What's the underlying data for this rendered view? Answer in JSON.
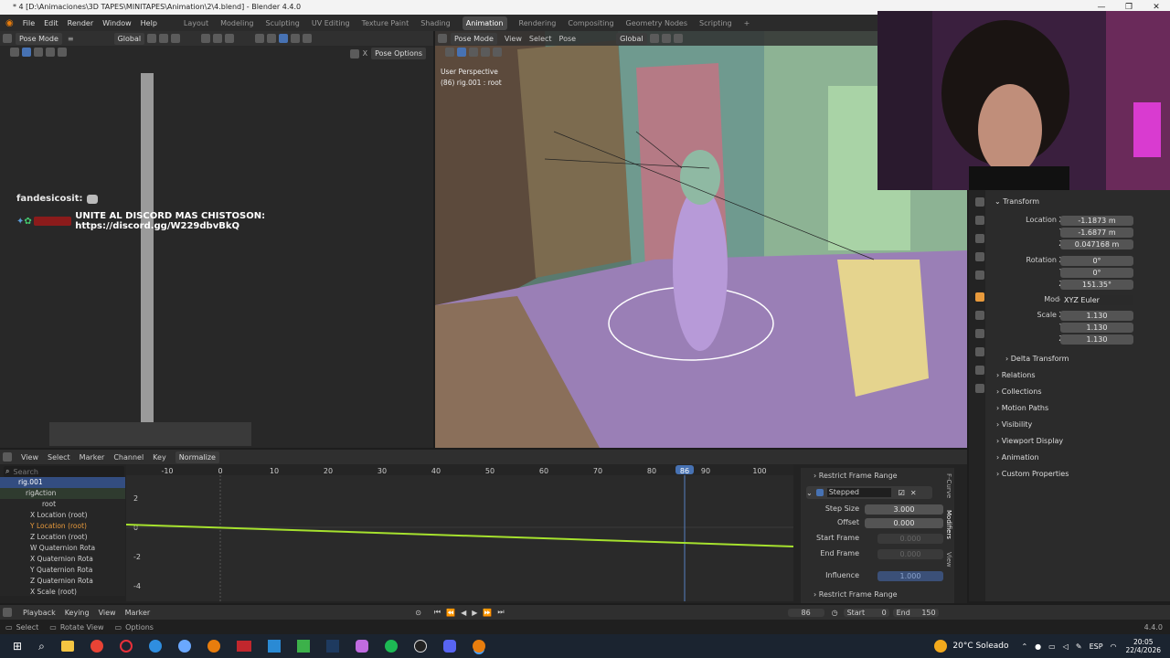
{
  "window": {
    "title": "* 4 [D:\\Animaciones\\3D TAPES\\MINITAPES\\Animation\\2\\4.blend] - Blender 4.4.0",
    "controls": [
      "—",
      "❐",
      "✕"
    ]
  },
  "menu": {
    "items": [
      "File",
      "Edit",
      "Render",
      "Window",
      "Help"
    ]
  },
  "workspaces": {
    "tabs": [
      "Layout",
      "Modeling",
      "Sculpting",
      "UV Editing",
      "Texture Paint",
      "Shading",
      "Animation",
      "Rendering",
      "Compositing",
      "Geometry Nodes",
      "Scripting"
    ],
    "active": "Animation",
    "add": "+"
  },
  "left_header": {
    "mode": "Pose Mode",
    "orientation": "Global",
    "pose_options": "Pose Options"
  },
  "viewport": {
    "mode": "Pose Mode",
    "view": "View",
    "select": "Select",
    "pose": "Pose",
    "orientation": "Global",
    "perspective": "User Perspective",
    "object": "(86) rig.001 : root"
  },
  "chat": {
    "user": "fandesicosit:",
    "user2": "",
    "message": "UNITE AL DISCORD MAS CHISTOSON: https://discord.gg/W229dbvBkQ"
  },
  "properties": {
    "section_transform": "Transform",
    "location": {
      "label": "Location X",
      "x": "-1.1873 m",
      "y": "-1.6877 m",
      "z": "0.047168 m"
    },
    "rotation": {
      "label": "Rotation X",
      "x": "0°",
      "y": "0°",
      "z": "151.35°"
    },
    "mode": {
      "label": "Mode",
      "value": "XYZ Euler"
    },
    "scale": {
      "label": "Scale X",
      "x": "1.130",
      "y": "1.130",
      "z": "1.130"
    },
    "axis_y": "Y",
    "axis_z": "Z",
    "delta": "Delta Transform",
    "sections": [
      "Relations",
      "Collections",
      "Motion Paths",
      "Visibility",
      "Viewport Display",
      "Animation",
      "Custom Properties"
    ]
  },
  "graph_header": {
    "view": "View",
    "select": "Select",
    "marker": "Marker",
    "channel": "Channel",
    "key": "Key",
    "normalize": "Normalize"
  },
  "graph": {
    "search_placeholder": "Search",
    "frame_ticks": [
      "-10",
      "0",
      "10",
      "20",
      "30",
      "40",
      "50",
      "60",
      "70",
      "80",
      "86",
      "90",
      "100"
    ],
    "value_ticks": [
      "2",
      "0",
      "-2",
      "-4"
    ],
    "current_frame": "86",
    "channels": [
      "rig.001",
      "rigAction",
      "root",
      "X Location (root)",
      "Y Location (root)",
      "Z Location (root)",
      "W Quaternion Rota",
      "X Quaternion Rota",
      "Y Quaternion Rota",
      "Z Quaternion Rota",
      "X Scale (root)"
    ]
  },
  "modifier": {
    "restrict": "Restrict Frame Range",
    "name": "Stepped",
    "step_size": {
      "label": "Step Size",
      "value": "3.000"
    },
    "offset": {
      "label": "Offset",
      "value": "0.000"
    },
    "start_frame": {
      "label": "Start Frame",
      "value": "0.000"
    },
    "end_frame": {
      "label": "End Frame",
      "value": "0.000"
    },
    "influence": {
      "label": "Influence",
      "value": "1.000"
    },
    "restrict2": "Restrict Frame Range",
    "side_tabs": [
      "F-Curve",
      "Modifiers",
      "View"
    ]
  },
  "timeline": {
    "playback": "Playback",
    "keying": "Keying",
    "view": "View",
    "marker": "Marker",
    "frame": "86",
    "start_label": "Start",
    "start": "0",
    "end_label": "End",
    "end": "150"
  },
  "status": {
    "select": "Select",
    "rotate": "Rotate View",
    "options": "Options",
    "version": "4.4.0"
  },
  "taskbar": {
    "weather": "20°C  Soleado",
    "lang": "ESP",
    "time": "20:05",
    "date": "22/4/2026"
  },
  "colors": {
    "accent": "#4772b3",
    "active_frame": "#5680c2",
    "curve": "#a6e22e",
    "orange": "#e89a3c",
    "viewport_floor": "#9a7fb6"
  }
}
